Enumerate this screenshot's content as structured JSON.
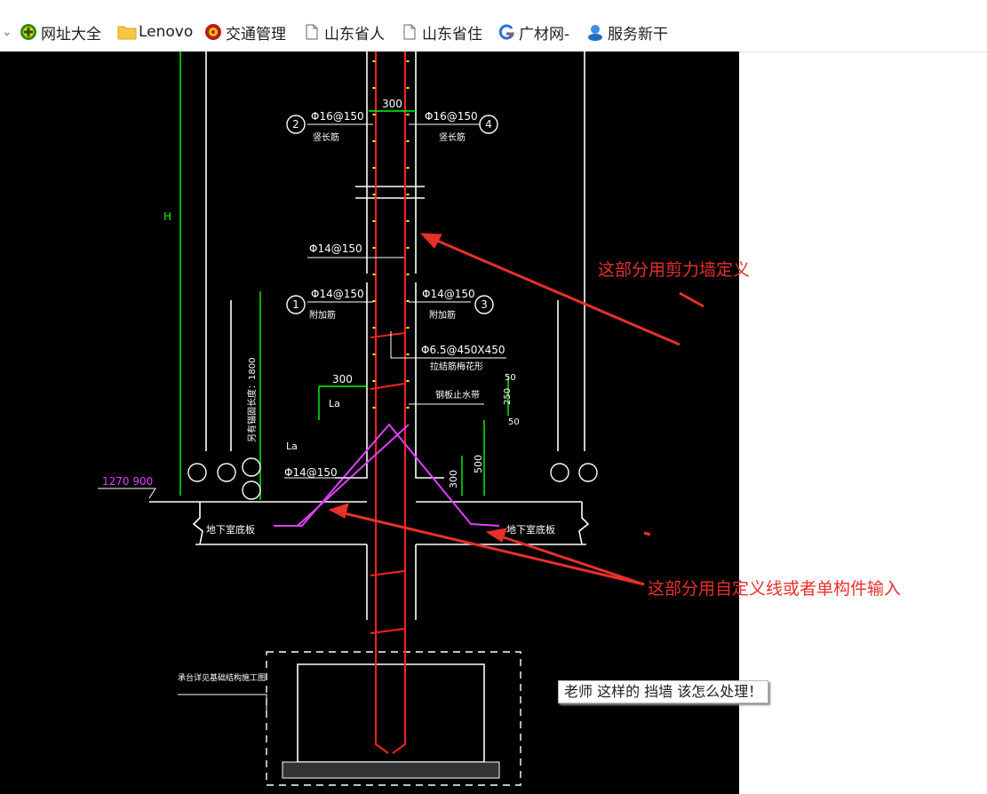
{
  "bookmarks": [
    {
      "label": "网址大全",
      "icon": "plus-circle-icon"
    },
    {
      "label": "Lenovo",
      "icon": "folder-icon"
    },
    {
      "label": "交通管理",
      "icon": "emblem-icon"
    },
    {
      "label": "山东省人",
      "icon": "page-icon"
    },
    {
      "label": "山东省住",
      "icon": "page-icon"
    },
    {
      "label": "广材网-",
      "icon": "g-logo-icon"
    },
    {
      "label": "服务新干",
      "icon": "service-icon"
    }
  ],
  "drawing": {
    "top_width": "300",
    "rebar_2": "Φ16@150",
    "rebar_4": "Φ16@150",
    "rebar_2_note": "竖长筋",
    "rebar_4_note": "竖长筋",
    "height_label": "H",
    "rebar_inner": "Φ14@150",
    "rebar_1": "Φ14@150",
    "rebar_3": "Φ14@150",
    "rebar_1_note": "附加筋",
    "rebar_3_note": "附加筋",
    "tie_bar": "Φ6.5@450X450",
    "tie_note": "拉结筋梅花形",
    "dim_300": "300",
    "dim_50_top": "50",
    "dim_250": "250",
    "dim_50_bottom": "50",
    "waterstop": "钢板止水带",
    "anchor_label": "另有锚固长度：1800",
    "la_1": "La",
    "la_2": "La",
    "haunch_rebar": "Φ14@150",
    "dim_500": "500",
    "dim_300_v": "300",
    "elevation": "1270  900",
    "slab_left": "地下室底板",
    "slab_right": "地下室底板",
    "foundation_note": "承台详见基础结构施工图",
    "markers": [
      "1",
      "2",
      "3",
      "4"
    ]
  },
  "annotations": {
    "shear_wall": "这部分用剪力墙定义",
    "custom_line": "这部分用自定义线或者单构件输入"
  },
  "question": "老师   这样的 挡墙 该怎么处理！",
  "colors": {
    "canvas": "#000000",
    "cad_white": "#ffffff",
    "cad_green": "#00ff00",
    "cad_red": "#ff2020",
    "cad_yellow": "#ffff00",
    "cad_magenta": "#e040ff",
    "annotation_red": "#e8302a"
  }
}
